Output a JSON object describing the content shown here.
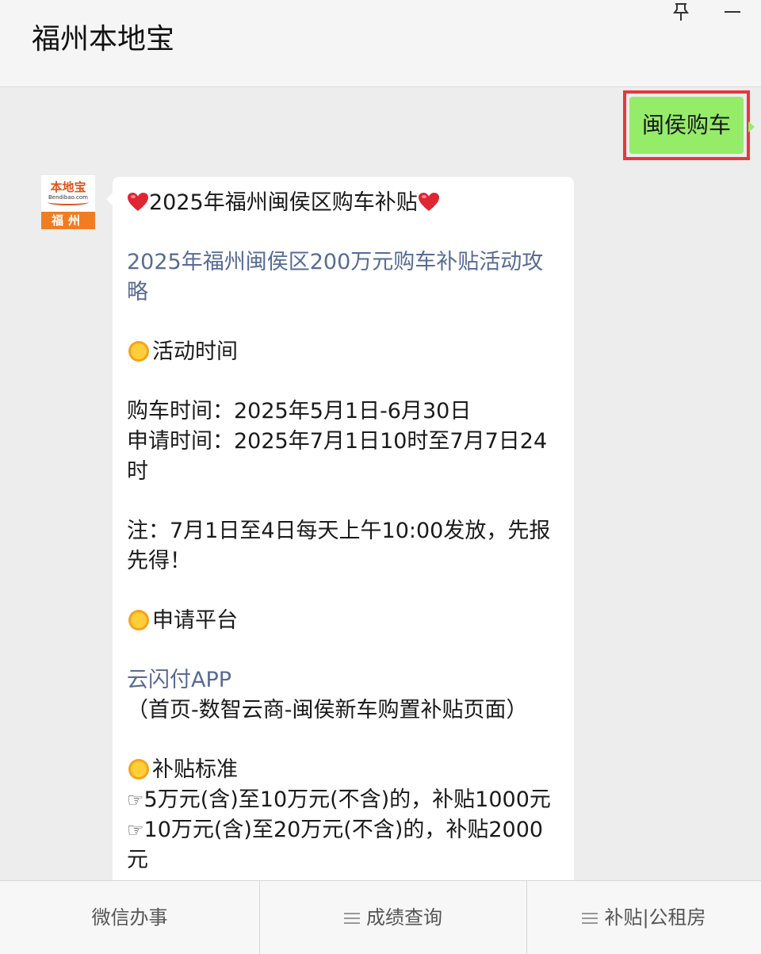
{
  "header": {
    "title": "福州本地宝",
    "icons": [
      "pin-icon",
      "minimize-icon"
    ]
  },
  "sent_message": {
    "text": "闽侯购车",
    "bubble_color": "#95ec69",
    "highlight_color": "#e5383b"
  },
  "avatar": {
    "logo_text": "本地宝",
    "logo_site": "Bendibao.com",
    "city": "福州",
    "brand_color": "#f07d22"
  },
  "reply": {
    "title": "2025年福州闽侯区购车补贴",
    "link_title": "2025年福州闽侯区200万元购车补贴活动攻略",
    "section_time": "活动时间",
    "purchase_time": "购车时间：2025年5月1日-6月30日",
    "apply_time": "申请时间：2025年7月1日10时至7月7日24时",
    "note": "注：7月1日至4日每天上午10:00发放，先报先得！",
    "section_platform": "申请平台",
    "platform_link": "云闪付APP",
    "platform_path": "（首页-数智云商-闽侯新车购置补贴页面）",
    "section_standard": "补贴标准",
    "standard_1": "5万元(含)至10万元(不含)的，补贴1000元",
    "standard_2": "10万元(含)至20万元(不含)的，补贴2000元",
    "link_color": "#576b95"
  },
  "footer": {
    "tabs": [
      {
        "label": "微信办事",
        "has_menu_icon": false
      },
      {
        "label": "成绩查询",
        "has_menu_icon": true
      },
      {
        "label": "补贴|公租房",
        "has_menu_icon": true
      }
    ]
  }
}
